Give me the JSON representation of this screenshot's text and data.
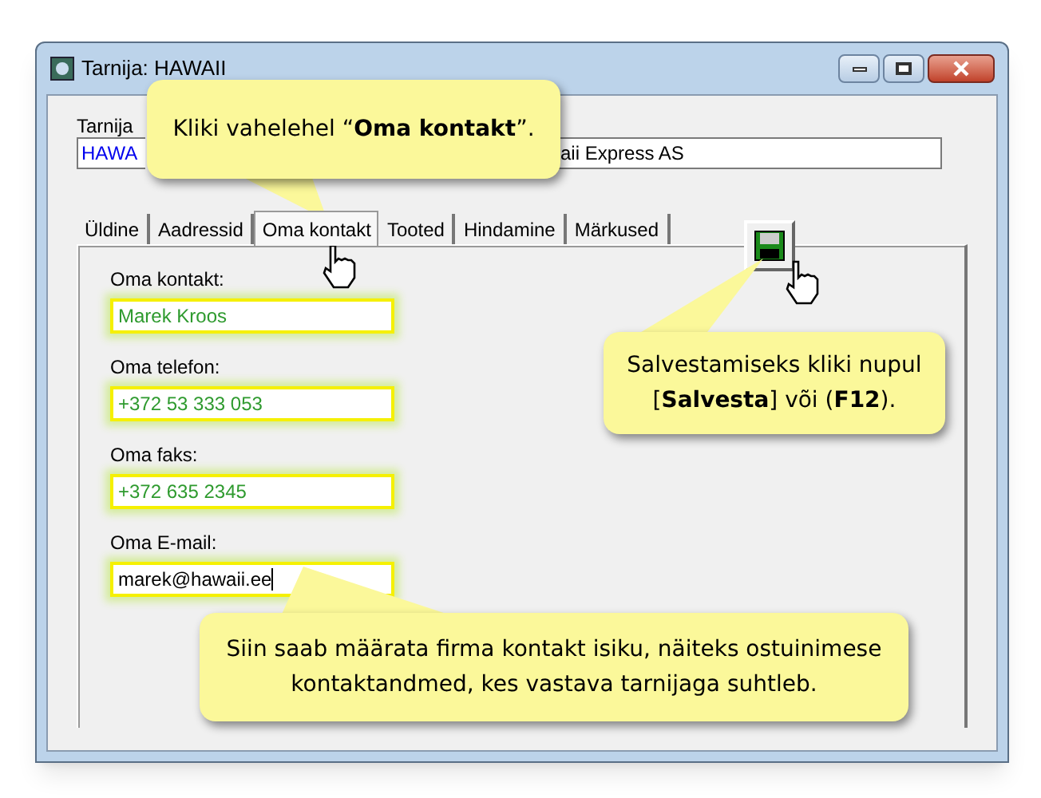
{
  "window": {
    "title": "Tarnija: HAWAII"
  },
  "header_fields": [
    {
      "label": "Tarnija",
      "value": "HAWA"
    },
    {
      "value": "aii Express AS"
    }
  ],
  "tabs": [
    {
      "label": "Üldine",
      "selected": false
    },
    {
      "label": "Aadressid",
      "selected": false
    },
    {
      "label": "Oma kontakt",
      "selected": true
    },
    {
      "label": "Tooted",
      "selected": false
    },
    {
      "label": "Hindamine",
      "selected": false
    },
    {
      "label": "Märkused",
      "selected": false
    }
  ],
  "contact_fields": [
    {
      "label": "Oma kontakt:",
      "value": "Marek Kroos",
      "focused": false
    },
    {
      "label": "Oma telefon:",
      "value": "+372 53 333 053",
      "focused": false
    },
    {
      "label": "Oma faks:",
      "value": "+372 635 2345",
      "focused": false
    },
    {
      "label": "Oma E-mail:",
      "value": "marek@hawaii.ee",
      "focused": true
    }
  ],
  "callouts": [
    {
      "text": "Kliki vahelehel “**Oma kontakt**”."
    },
    {
      "text": "Salvestamiseks kliki nupul [**Salvesta**] või (**F12**)."
    },
    {
      "text": "Siin saab määrata firma kontakt isiku, näiteks ostuinimese kontaktandmed, kes vastava tarnijaga suhtleb."
    }
  ]
}
